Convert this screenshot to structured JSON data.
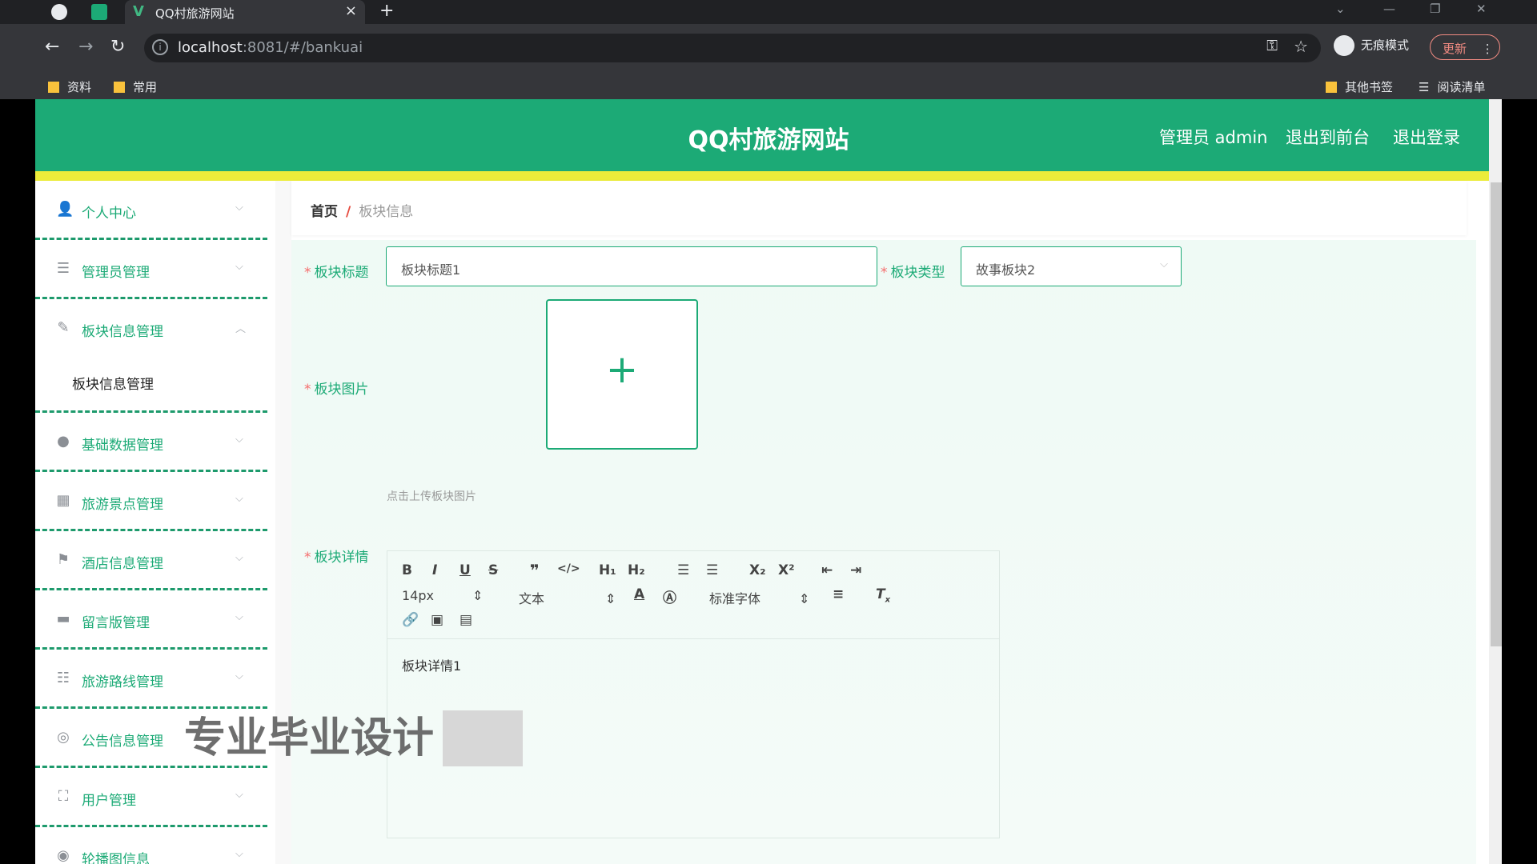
{
  "browser": {
    "tab_title": "QQ村旅游网站",
    "url_host": "localhost",
    "url_rest": ":8081/#/bankuai",
    "incognito_label": "无痕模式",
    "update_label": "更新",
    "bookmarks": [
      "资料",
      "常用"
    ],
    "bookmarks_right": [
      "其他书签",
      "阅读清单"
    ]
  },
  "header": {
    "title": "QQ村旅游网站",
    "admin": "管理员 admin",
    "to_front": "退出到前台",
    "logout": "退出登录"
  },
  "sidebar": {
    "items": [
      {
        "label": "个人中心",
        "icon": "user-icon"
      },
      {
        "label": "管理员管理",
        "icon": "list-icon"
      },
      {
        "label": "板块信息管理",
        "icon": "edit-icon",
        "expanded": true,
        "sub": "板块信息管理"
      },
      {
        "label": "基础数据管理",
        "icon": "pin-icon"
      },
      {
        "label": "旅游景点管理",
        "icon": "grid-icon"
      },
      {
        "label": "酒店信息管理",
        "icon": "flag-icon"
      },
      {
        "label": "留言版管理",
        "icon": "message-icon"
      },
      {
        "label": "旅游路线管理",
        "icon": "sliders-icon"
      },
      {
        "label": "公告信息管理",
        "icon": "compass-icon"
      },
      {
        "label": "用户管理",
        "icon": "frame-icon"
      },
      {
        "label": "轮播图信息",
        "icon": "circle-icon"
      }
    ]
  },
  "breadcrumb": {
    "home": "首页",
    "sep": "/",
    "current": "板块信息"
  },
  "form": {
    "title_label": "板块标题",
    "title_value": "板块标题1",
    "type_label": "板块类型",
    "type_value": "故事板块2",
    "image_label": "板块图片",
    "image_tip": "点击上传板块图片",
    "detail_label": "板块详情",
    "detail_value": "板块详情1"
  },
  "editor": {
    "font_size": "14px",
    "format": "文本",
    "font_family": "标准字体"
  },
  "watermark": "专业毕业设计",
  "colors": {
    "brand": "#1caa76",
    "accent_yellow": "#ecec3a"
  }
}
